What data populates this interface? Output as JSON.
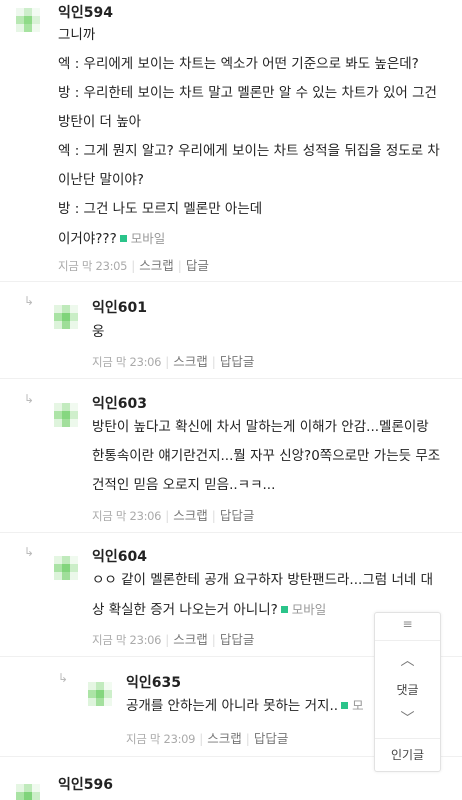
{
  "colors": {
    "mobile_dot": "#2bc48a",
    "avatar_green": "#7fd47a"
  },
  "comments": [
    {
      "author": "익인594",
      "lines": [
        "그니까",
        "엑 : 우리에게 보이는 차트는 엑소가 어떤 기준으로 봐도 높은데?",
        "방 : 우리한테 보이는 차트 말고 멜론만 알 수 있는 차트가 있어 그건",
        "방탄이 더 높아",
        "엑 : 그게 뭔지 알고? 우리에게 보이는 차트 성적을 뒤집을 정도로 차",
        "이난단 말이야?",
        "방 : 그건 나도 모르지 멜론만 아는데",
        "이거야???"
      ],
      "mobile": "모바일",
      "time": "지금 막 23:05",
      "actions": [
        "스크랩",
        "답글"
      ]
    },
    {
      "author": "익인601",
      "lines": [
        "웅"
      ],
      "time": "지금 막 23:06",
      "actions": [
        "스크랩",
        "답답글"
      ]
    },
    {
      "author": "익인603",
      "lines": [
        "방탄이 높다고 확신에 차서 말하는게 이해가 안감...멜론이랑",
        "한통속이란 얘기란건지...뭘 자꾸 신앙?0쪽으로만 가는듯 무조",
        "건적인 믿음 오로지 믿음..ㅋㅋ..."
      ],
      "time": "지금 막 23:06",
      "actions": [
        "스크랩",
        "답답글"
      ]
    },
    {
      "author": "익인604",
      "lines": [
        "ㅇㅇ 같이 멜론한테 공개 요구하자 방탄팬드라...그럼 너네 대",
        "상 확실한 증거 나오는거 아니니?"
      ],
      "mobile": "모바일",
      "time": "지금 막 23:06",
      "actions": [
        "스크랩",
        "답답글"
      ]
    },
    {
      "author": "익인635",
      "lines": [
        "공개를 안하는게 아니라 못하는 거지.."
      ],
      "mobile": "모",
      "time": "지금 막 23:09",
      "actions": [
        "스크랩",
        "답답글"
      ]
    },
    {
      "author": "익인596"
    }
  ],
  "float_nav": {
    "menu_icon": "≡",
    "up_icon": "︿",
    "label_comments": "댓글",
    "down_icon": "﹀",
    "label_popular": "인기글"
  },
  "icons": {
    "reply_arrow": "↳"
  }
}
